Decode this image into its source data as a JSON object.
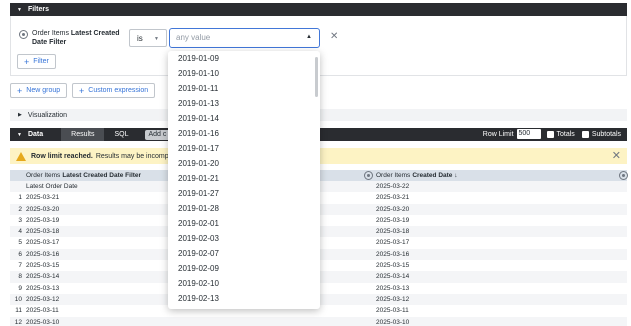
{
  "filters_bar": {
    "title": "Filters"
  },
  "filter": {
    "label_prefix": "Order Items ",
    "label_field": "Latest Created Date Filter",
    "operator": "is",
    "value_placeholder": "any value"
  },
  "buttons": {
    "add_filter": "Filter",
    "new_group": "New group",
    "custom_expression": "Custom expression"
  },
  "visualization": {
    "title": "Visualization"
  },
  "data_bar": {
    "title": "Data",
    "tabs": [
      "Results",
      "SQL"
    ],
    "add_calc": "Add c",
    "row_limit_label": "Row Limit",
    "row_limit_value": "500",
    "totals_label": "Totals",
    "subtotals_label": "Subtotals"
  },
  "warning": {
    "bold": "Row limit reached.",
    "text": "Results may be incomplete"
  },
  "table": {
    "col1_prefix": "Order Items",
    "col1_field": "Latest Created Date Filter",
    "col2_prefix": "Order Items",
    "col2_field": "Created Date ↓",
    "row_numbers": [
      "",
      "1",
      "2",
      "3",
      "4",
      "5",
      "6",
      "7",
      "8",
      "9",
      "10",
      "11",
      "12",
      "13"
    ],
    "col1_values": [
      "Latest Order Date",
      "2025-03-21",
      "2025-03-20",
      "2025-03-19",
      "2025-03-18",
      "2025-03-17",
      "2025-03-16",
      "2025-03-15",
      "2025-03-14",
      "2025-03-13",
      "2025-03-12",
      "2025-03-11",
      "2025-03-10"
    ],
    "col2_values": [
      "2025-03-22",
      "2025-03-21",
      "2025-03-20",
      "2025-03-19",
      "2025-03-18",
      "2025-03-17",
      "2025-03-16",
      "2025-03-15",
      "2025-03-14",
      "2025-03-13",
      "2025-03-12",
      "2025-03-11",
      "2025-03-10"
    ]
  },
  "dropdown_options": [
    "2019-01-09",
    "2019-01-10",
    "2019-01-11",
    "2019-01-13",
    "2019-01-14",
    "2019-01-16",
    "2019-01-17",
    "2019-01-20",
    "2019-01-21",
    "2019-01-27",
    "2019-01-28",
    "2019-02-01",
    "2019-02-03",
    "2019-02-07",
    "2019-02-09",
    "2019-02-10",
    "2019-02-13"
  ],
  "colors": {
    "accent": "#3674d8",
    "dark_bar": "#2a2c30",
    "warning_bg": "#fdf3c4",
    "header_bg": "#d9e0e8"
  }
}
